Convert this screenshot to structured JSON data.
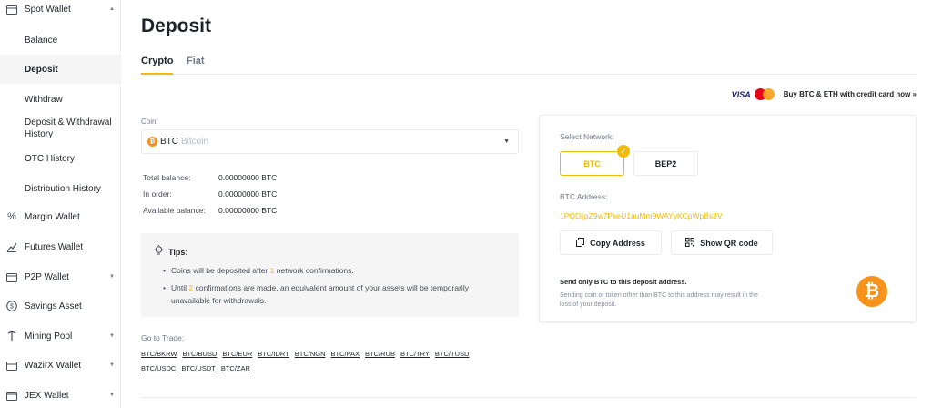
{
  "sidebar": {
    "items": [
      {
        "label": "Spot Wallet",
        "icon": "wallet-icon"
      },
      {
        "label": "Balance"
      },
      {
        "label": "Deposit"
      },
      {
        "label": "Withdraw"
      },
      {
        "label": "Deposit & Withdrawal History"
      },
      {
        "label": "OTC History"
      },
      {
        "label": "Distribution History"
      },
      {
        "label": "Margin Wallet",
        "icon": "percent-icon"
      },
      {
        "label": "Futures Wallet",
        "icon": "futures-icon"
      },
      {
        "label": "P2P Wallet",
        "icon": "wallet-icon"
      },
      {
        "label": "Savings Asset",
        "icon": "dollar-icon"
      },
      {
        "label": "Mining Pool",
        "icon": "mining-icon"
      },
      {
        "label": "WazirX Wallet",
        "icon": "wallet-icon"
      },
      {
        "label": "JEX Wallet",
        "icon": "wallet-icon"
      }
    ]
  },
  "page": {
    "title": "Deposit",
    "tabs": [
      "Crypto",
      "Fiat"
    ],
    "promo": {
      "visa": "VISA",
      "text": "Buy BTC & ETH with credit card now »"
    }
  },
  "coin": {
    "label": "Coin",
    "symbol": "BTC",
    "name": "Bitcoin"
  },
  "balances": [
    {
      "label": "Total balance:",
      "value": "0.00000000 BTC"
    },
    {
      "label": "In order:",
      "value": "0.00000000 BTC"
    },
    {
      "label": "Available balance:",
      "value": "0.00000000 BTC"
    }
  ],
  "tips": {
    "title": "Tips:",
    "tip1": {
      "pre": "Coins will be deposited after ",
      "num": "1",
      "post": " network confirmations."
    },
    "tip2": {
      "pre": "Until ",
      "num": "2",
      "post": " confirmations are made, an equivalent amount of your assets will be temporarily unavailable for withdrawals."
    }
  },
  "trade": {
    "label": "Go to Trade:",
    "pairs": [
      "BTC/BKRW",
      "BTC/BUSD",
      "BTC/EUR",
      "BTC/IDRT",
      "BTC/NGN",
      "BTC/PAX",
      "BTC/RUB",
      "BTC/TRY",
      "BTC/TUSD",
      "BTC/USDC",
      "BTC/USDT",
      "BTC/ZAR"
    ]
  },
  "network": {
    "label": "Select Network:",
    "options": [
      "BTC",
      "BEP2"
    ],
    "selected": "BTC",
    "address_label": "BTC Address:",
    "address": "1PQDijpZ9w7PkeU1auMm9WAYyKCpWpBs8V",
    "copy_label": "Copy Address",
    "qr_label": "Show QR code",
    "warning_title": "Send only BTC to this deposit address.",
    "warning_text": "Sending coin or token other than BTC to this address may result in the loss of your deposit."
  },
  "colors": {
    "accent": "#f0b90b",
    "bitcoin": "#f7931a"
  }
}
